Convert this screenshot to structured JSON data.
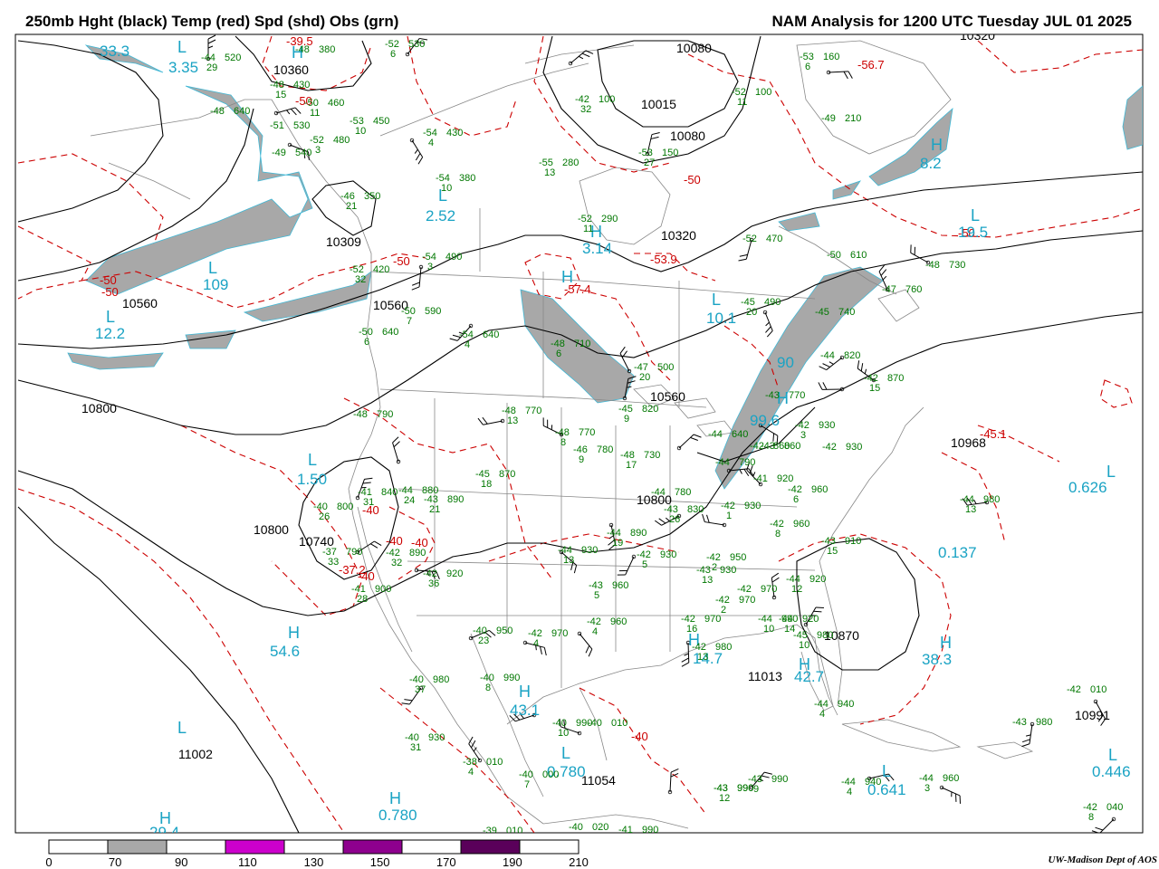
{
  "header": {
    "left_title": "250mb Hght (black) Temp (red) Spd (shd) Obs (grn)",
    "right_title": "NAM Analysis for 1200 UTC Tuesday  JUL 01 2025"
  },
  "footer": {
    "credit": "UW-Madison  Dept of AOS"
  },
  "colors": {
    "height_contour": "#000000",
    "temperature": "#cc0000",
    "speed_label": "#1aa3c4",
    "observations": "#007700",
    "geography": "#888888",
    "shade_70_90": "#a8a8a8",
    "shade_110_130": "#cc00cc",
    "shade_150_170": "#8e008e",
    "shade_190_210": "#5a005a"
  },
  "colorbar": {
    "ticks": [
      "0",
      "70",
      "90",
      "110",
      "130",
      "150",
      "170",
      "190",
      "210"
    ],
    "fills": [
      "#ffffff",
      "#a8a8a8",
      "#ffffff",
      "#cc00cc",
      "#ffffff",
      "#8e008e",
      "#ffffff",
      "#5a005a",
      "#ffffff"
    ]
  },
  "height_labels": [
    "10080",
    "10015",
    "10080",
    "10320",
    "10360",
    "10309",
    "10560",
    "10320",
    "10800",
    "10800",
    "10740",
    "10560",
    "10560",
    "10968",
    "10800",
    "10870",
    "11013",
    "10991",
    "11002",
    "11054"
  ],
  "temp_labels": [
    "-39.5",
    "-50",
    "-50",
    "-50",
    "-50",
    "-50",
    "-56.7",
    "-53.9",
    "-57.4",
    "-50",
    "-45.1",
    "-40",
    "-40",
    "-40",
    "-37.2",
    "-40",
    "-40"
  ],
  "speed_labels": [
    "33.3",
    "3.35",
    "2.52",
    "3.14",
    "109",
    "12.2",
    "10.1",
    "90",
    "99.6",
    "8.2",
    "19.5",
    "1.50",
    "0.626",
    "0.137",
    "54.6",
    "38.3",
    "43.1",
    "14.7",
    "42.7",
    "0.780",
    "0.780",
    "0.641",
    "0.446",
    "29.4"
  ],
  "pressure_centers": [
    "L",
    "H",
    "L",
    "H",
    "L",
    "L",
    "H",
    "L",
    "L",
    "H",
    "H",
    "L",
    "H",
    "L",
    "H",
    "H",
    "H",
    "H",
    "L",
    "L",
    "H",
    "L",
    "L",
    "H"
  ],
  "observations": [
    {
      "t": "-44",
      "h": "520",
      "d": "29"
    },
    {
      "t": "-52",
      "h": "530",
      "d": "6"
    },
    {
      "t": "-48",
      "h": "380",
      "d": ""
    },
    {
      "t": "-48",
      "h": "430",
      "d": "15"
    },
    {
      "t": "-50",
      "h": "460",
      "d": "11"
    },
    {
      "t": "-48",
      "h": "640",
      "d": ""
    },
    {
      "t": "-53",
      "h": "450",
      "d": "10"
    },
    {
      "t": "-51",
      "h": "530",
      "d": ""
    },
    {
      "t": "-52",
      "h": "480",
      "d": "3"
    },
    {
      "t": "-49",
      "h": "540",
      "d": ""
    },
    {
      "t": "-54",
      "h": "430",
      "d": "4"
    },
    {
      "t": "-42",
      "h": "100",
      "d": "32"
    },
    {
      "t": "-55",
      "h": "280",
      "d": "13"
    },
    {
      "t": "-53",
      "h": "150",
      "d": "27"
    },
    {
      "t": "-53",
      "h": "160",
      "d": "6"
    },
    {
      "t": "-52",
      "h": "100",
      "d": "11"
    },
    {
      "t": "-49",
      "h": "210",
      "d": ""
    },
    {
      "t": "-54",
      "h": "380",
      "d": "10"
    },
    {
      "t": "-46",
      "h": "350",
      "d": "21"
    },
    {
      "t": "-52",
      "h": "290",
      "d": "11"
    },
    {
      "t": "-52",
      "h": "470",
      "d": ""
    },
    {
      "t": "-50",
      "h": "610",
      "d": ""
    },
    {
      "t": "-48",
      "h": "730",
      "d": ""
    },
    {
      "t": "-47",
      "h": "760",
      "d": ""
    },
    {
      "t": "-52",
      "h": "420",
      "d": "32"
    },
    {
      "t": "-54",
      "h": "490",
      "d": "3"
    },
    {
      "t": "-50",
      "h": "590",
      "d": "7"
    },
    {
      "t": "-45",
      "h": "490",
      "d": "20"
    },
    {
      "t": "-45",
      "h": "740",
      "d": ""
    },
    {
      "t": "-50",
      "h": "640",
      "d": "6"
    },
    {
      "t": "-54",
      "h": "640",
      "d": "4"
    },
    {
      "t": "-47",
      "h": "500",
      "d": "20"
    },
    {
      "t": "-44",
      "h": "820",
      "d": ""
    },
    {
      "t": "-42",
      "h": "870",
      "d": "15"
    },
    {
      "t": "-48",
      "h": "710",
      "d": "6"
    },
    {
      "t": "-48",
      "h": "790",
      "d": ""
    },
    {
      "t": "-48",
      "h": "770",
      "d": "13"
    },
    {
      "t": "-45",
      "h": "820",
      "d": "9"
    },
    {
      "t": "-43",
      "h": "770",
      "d": ""
    },
    {
      "t": "-48",
      "h": "770",
      "d": "8"
    },
    {
      "t": "-46",
      "h": "780",
      "d": "9"
    },
    {
      "t": "-48",
      "h": "730",
      "d": "17"
    },
    {
      "t": "-44",
      "h": "640",
      "d": ""
    },
    {
      "t": "-42",
      "h": "930",
      "d": "3"
    },
    {
      "t": "-42",
      "h": "860",
      "d": ""
    },
    {
      "t": "-42",
      "h": "930",
      "d": ""
    },
    {
      "t": "-43",
      "h": "860",
      "d": ""
    },
    {
      "t": "-45",
      "h": "870",
      "d": "18"
    },
    {
      "t": "-44",
      "h": "790",
      "d": ""
    },
    {
      "t": "-44",
      "h": "880",
      "d": "24"
    },
    {
      "t": "-43",
      "h": "890",
      "d": "21"
    },
    {
      "t": "-41",
      "h": "840",
      "d": "31"
    },
    {
      "t": "-40",
      "h": "800",
      "d": "26"
    },
    {
      "t": "-44",
      "h": "780",
      "d": ""
    },
    {
      "t": "-41",
      "h": "920",
      "d": ""
    },
    {
      "t": "-42",
      "h": "960",
      "d": "6"
    },
    {
      "t": "-44",
      "h": "980",
      "d": "13"
    },
    {
      "t": "-43",
      "h": "830",
      "d": "26"
    },
    {
      "t": "-42",
      "h": "930",
      "d": "1"
    },
    {
      "t": "-42",
      "h": "960",
      "d": "8"
    },
    {
      "t": "-43",
      "h": "910",
      "d": "15"
    },
    {
      "t": "-37",
      "h": "790",
      "d": "33"
    },
    {
      "t": "-42",
      "h": "890",
      "d": "32"
    },
    {
      "t": "-44",
      "h": "890",
      "d": "19"
    },
    {
      "t": "-44",
      "h": "930",
      "d": "13"
    },
    {
      "t": "-42",
      "h": "930",
      "d": "5"
    },
    {
      "t": "-42",
      "h": "950",
      "d": "2"
    },
    {
      "t": "-44",
      "h": "920",
      "d": "12"
    },
    {
      "t": "-43",
      "h": "930",
      "d": "13"
    },
    {
      "t": "-41",
      "h": "900",
      "d": "28"
    },
    {
      "t": "-42",
      "h": "920",
      "d": "36"
    },
    {
      "t": "-43",
      "h": "960",
      "d": "5"
    },
    {
      "t": "-42",
      "h": "970",
      "d": "2"
    },
    {
      "t": "-42",
      "h": "970",
      "d": ""
    },
    {
      "t": "-44",
      "h": "920",
      "d": "14"
    },
    {
      "t": "-42",
      "h": "960",
      "d": "4"
    },
    {
      "t": "-40",
      "h": "950",
      "d": "23"
    },
    {
      "t": "-42",
      "h": "970",
      "d": "4"
    },
    {
      "t": "-42",
      "h": "970",
      "d": "16"
    },
    {
      "t": "-42",
      "h": "980",
      "d": "13"
    },
    {
      "t": "-45",
      "h": "980",
      "d": "10"
    },
    {
      "t": "-44",
      "h": "990",
      "d": "10"
    },
    {
      "t": "-40",
      "h": "980",
      "d": "37"
    },
    {
      "t": "-40",
      "h": "990",
      "d": "8"
    },
    {
      "t": "-43",
      "h": "990",
      "d": ""
    },
    {
      "t": "-44",
      "h": "940",
      "d": "4"
    },
    {
      "t": "-42",
      "h": "010",
      "d": ""
    },
    {
      "t": "-43",
      "h": "980",
      "d": ""
    },
    {
      "t": "-40",
      "h": "990",
      "d": "10"
    },
    {
      "t": "-40",
      "h": "010",
      "d": ""
    },
    {
      "t": "-40",
      "h": "930",
      "d": "31"
    },
    {
      "t": "-38",
      "h": "010",
      "d": "4"
    },
    {
      "t": "-40",
      "h": "000",
      "d": "7"
    },
    {
      "t": "-43",
      "h": "990",
      "d": "12"
    },
    {
      "t": "-43",
      "h": "990",
      "d": "9"
    },
    {
      "t": "-44",
      "h": "940",
      "d": "4"
    },
    {
      "t": "-44",
      "h": "960",
      "d": "3"
    },
    {
      "t": "-39",
      "h": "010",
      "d": ""
    },
    {
      "t": "-40",
      "h": "020",
      "d": ""
    },
    {
      "t": "-41",
      "h": "990",
      "d": ""
    },
    {
      "t": "-42",
      "h": "040",
      "d": "8"
    }
  ]
}
